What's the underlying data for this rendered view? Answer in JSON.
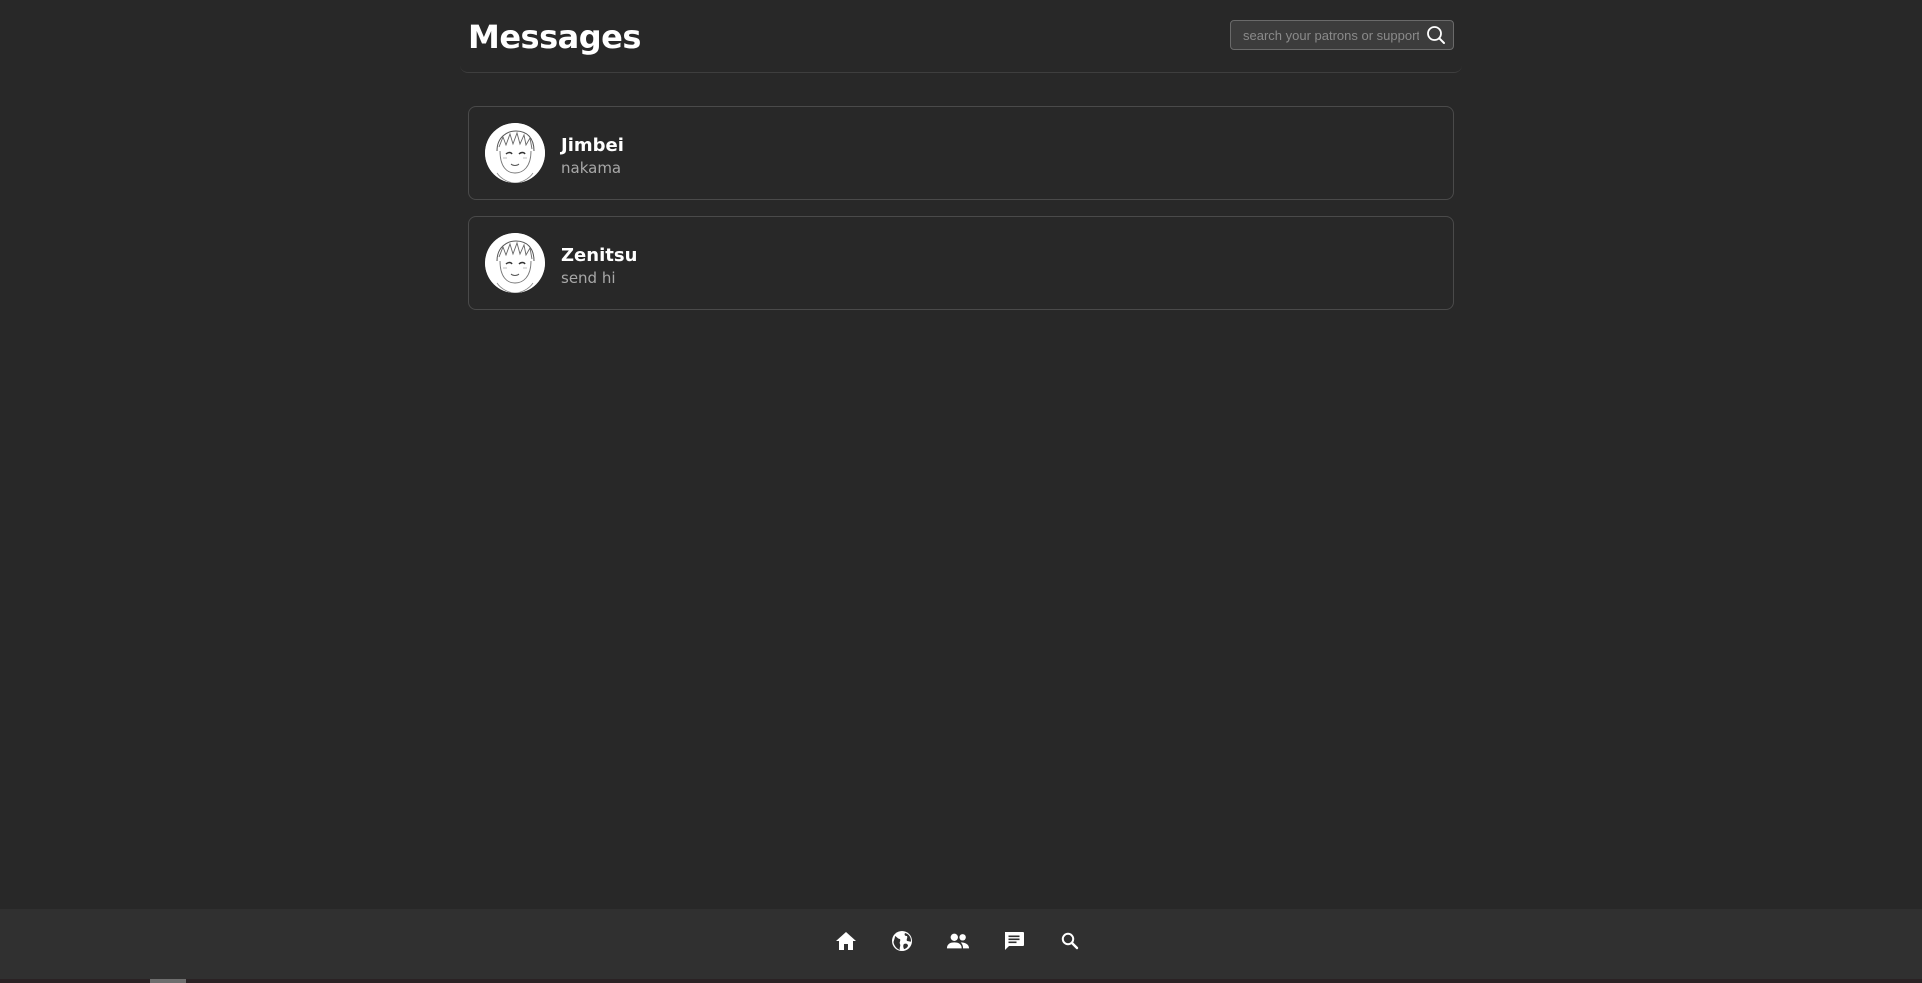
{
  "header": {
    "title": "Messages",
    "search": {
      "placeholder": "search your patrons or supporters",
      "value": ""
    }
  },
  "conversations": [
    {
      "name": "Jimbei",
      "preview": "nakama",
      "avatar_icon": "anime-avatar"
    },
    {
      "name": "Zenitsu",
      "preview": "send hi",
      "avatar_icon": "anime-avatar"
    }
  ],
  "bottom_nav": {
    "items": [
      {
        "icon": "home-icon"
      },
      {
        "icon": "globe-icon"
      },
      {
        "icon": "people-icon"
      },
      {
        "icon": "chat-icon"
      },
      {
        "icon": "search-icon"
      }
    ]
  },
  "colors": {
    "background": "#282828",
    "card_border": "#4a4a4a",
    "nav_background": "#303030",
    "text_primary": "#ffffff",
    "text_secondary": "#a8a8a8"
  }
}
